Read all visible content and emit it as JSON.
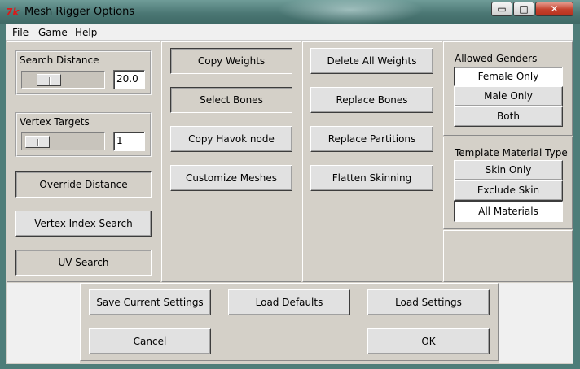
{
  "window": {
    "title": "Mesh Rigger Options",
    "app_icon": "tk-feather-icon",
    "buttons": {
      "minimize": "▭",
      "maximize": "□",
      "close": "✕"
    }
  },
  "menu": {
    "file": "File",
    "game": "Game",
    "help": "Help"
  },
  "search_distance": {
    "label": "Search Distance",
    "value": "20.0",
    "slider_level": 0.25
  },
  "vertex_targets": {
    "label": "Vertex Targets",
    "value": "1",
    "slider_level": 0.05
  },
  "left_buttons": {
    "override_distance": "Override Distance",
    "vertex_index_search": "Vertex Index Search",
    "uv_search": "UV Search"
  },
  "middle_buttons": {
    "copy_weights": "Copy Weights",
    "select_bones": "Select Bones",
    "copy_havok_node": "Copy Havok node",
    "customize_meshes": "Customize Meshes"
  },
  "right_buttons": {
    "delete_all_weights": "Delete All Weights",
    "replace_bones": "Replace Bones",
    "replace_partitions": "Replace Partitions",
    "flatten_skinning": "Flatten Skinning"
  },
  "allowed_genders": {
    "label": "Allowed Genders",
    "options": [
      "Female Only",
      "Male Only",
      "Both"
    ],
    "selected": "Female Only"
  },
  "template_material_type": {
    "label": "Template Material Type",
    "options": [
      "Skin Only",
      "Exclude Skin",
      "All Materials"
    ],
    "selected": "All Materials"
  },
  "bottom_buttons": {
    "save_current_settings": "Save Current Settings",
    "load_defaults": "Load Defaults",
    "load_settings": "Load Settings",
    "cancel": "Cancel",
    "ok": "OK"
  }
}
